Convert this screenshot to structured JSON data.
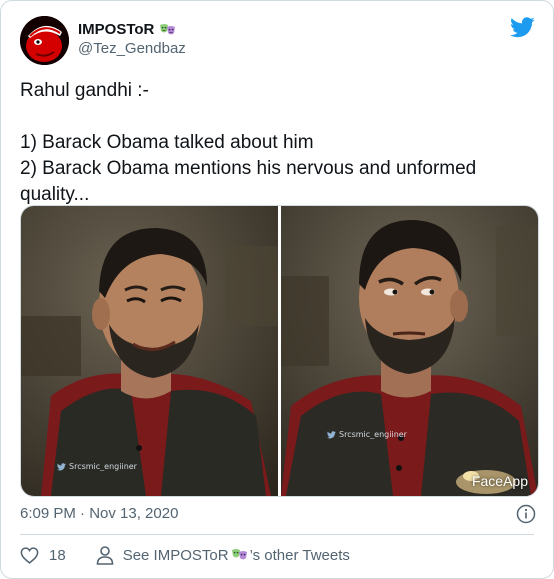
{
  "author": {
    "display_name": "IMPOSToR",
    "handle": "@Tez_Gendbaz",
    "badge_icon": "theater-masks-icon"
  },
  "tweet": {
    "text": "Rahul gandhi :-\n\n1) Barack Obama talked about him\n2) Barack Obama mentions his nervous and unformed quality..."
  },
  "media": {
    "left_watermark": "Srcsmic_engiiner",
    "right_watermark": "Srcsmic_engiiner",
    "faceapp_label": "FaceApp"
  },
  "footer": {
    "timestamp": "6:09 PM · Nov 13, 2020",
    "like_count": "18",
    "see_more_prefix": "See IMPOSToR",
    "see_more_suffix": "’s other Tweets"
  },
  "colors": {
    "twitter_blue": "#1d9bf0",
    "muted_text": "#536471",
    "border": "#cfd9de"
  }
}
